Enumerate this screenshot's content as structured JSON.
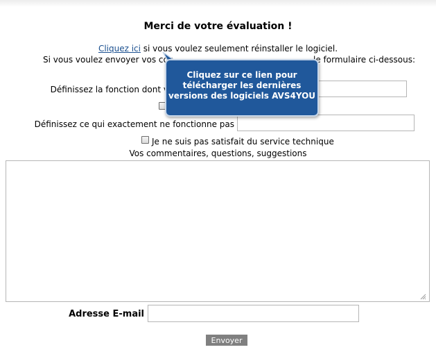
{
  "heading": "Merci de votre évaluation !",
  "intro": {
    "link_text": "Cliquez ici",
    "after_link": " si vous voulez seulement réinstaller le logiciel.",
    "line2_start": "Si vous voulez envoyer vos con",
    "line2_end": "le formulaire ci-dessous:"
  },
  "tooltip": {
    "text": "Cliquez sur ce lien pour télécharger les dernières versions des logiciels AVS4YOU"
  },
  "form": {
    "function_label_visible": "Définissez la fonction dont v",
    "function_value": "",
    "not_working_label": "Définissez ce qui exactement ne fonctionne pas",
    "not_working_value": "",
    "unsatisfied_label": "Je ne suis pas satisfait du service technique",
    "comments_label": "Vos commentaires, questions, suggestions",
    "comments_value": "",
    "email_label": "Adresse E-mail",
    "email_value": "",
    "submit_label": "Envoyer"
  },
  "colors": {
    "link": "#1a4f8f",
    "tooltip_bg": "#20589b",
    "button_bg": "#808080"
  }
}
